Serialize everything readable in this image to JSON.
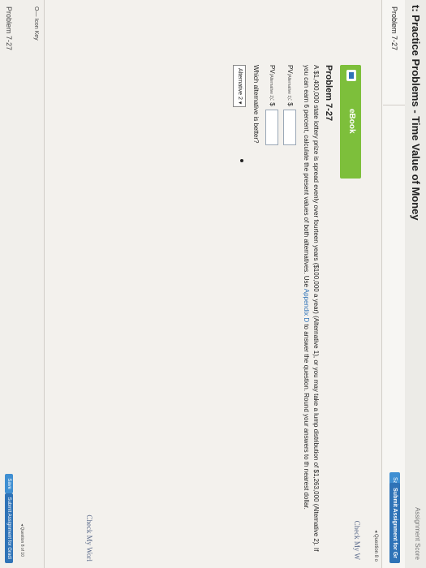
{
  "header": {
    "title": "t: Practice Problems - Time Value of Money",
    "assignment_score": "Assignment Score"
  },
  "tabs": [
    {
      "label": "Problem 7-27"
    }
  ],
  "toolbar": {
    "save_label": "Save",
    "submit_label": "Submit Assignment for Gr",
    "question_nav": "◂ Question 8 o"
  },
  "ebook": {
    "label": "eBook"
  },
  "check_my_work": "Check My W",
  "problem": {
    "heading": "Problem 7-27",
    "text_before_link": "A $1,400,000 state lottery prize is spread evenly over fourteen years ($100,000 a year) (Alternative 1), or you may take a lump distribution of $1,263,000 (Alternative 2). If you can earn 6 percent, calculate the present values of both alternatives. Use ",
    "link": "Appendix D",
    "text_after_link": " to answer the question. Round your answers to th nearest dollar.",
    "pv1_prefix": "PV",
    "pv1_sub": "(Alternative 1)",
    "pv1_suffix": ": $",
    "pv2_prefix": "PV",
    "pv2_sub": "(Alternative 2)",
    "pv2_suffix": ": $",
    "pv1_value": "",
    "pv2_value": "",
    "question": "Which alternative is better?",
    "selected_option": "Alternative 2 ▾"
  },
  "footer": {
    "icon_key": "O— Icon Key",
    "problem": "Problem 7-27",
    "save_label": "Save",
    "submit_label": "Submit Assignment for Gradi",
    "question_nav": "◂ Question 8 of 10",
    "check_my_work": "Check My Worl"
  }
}
